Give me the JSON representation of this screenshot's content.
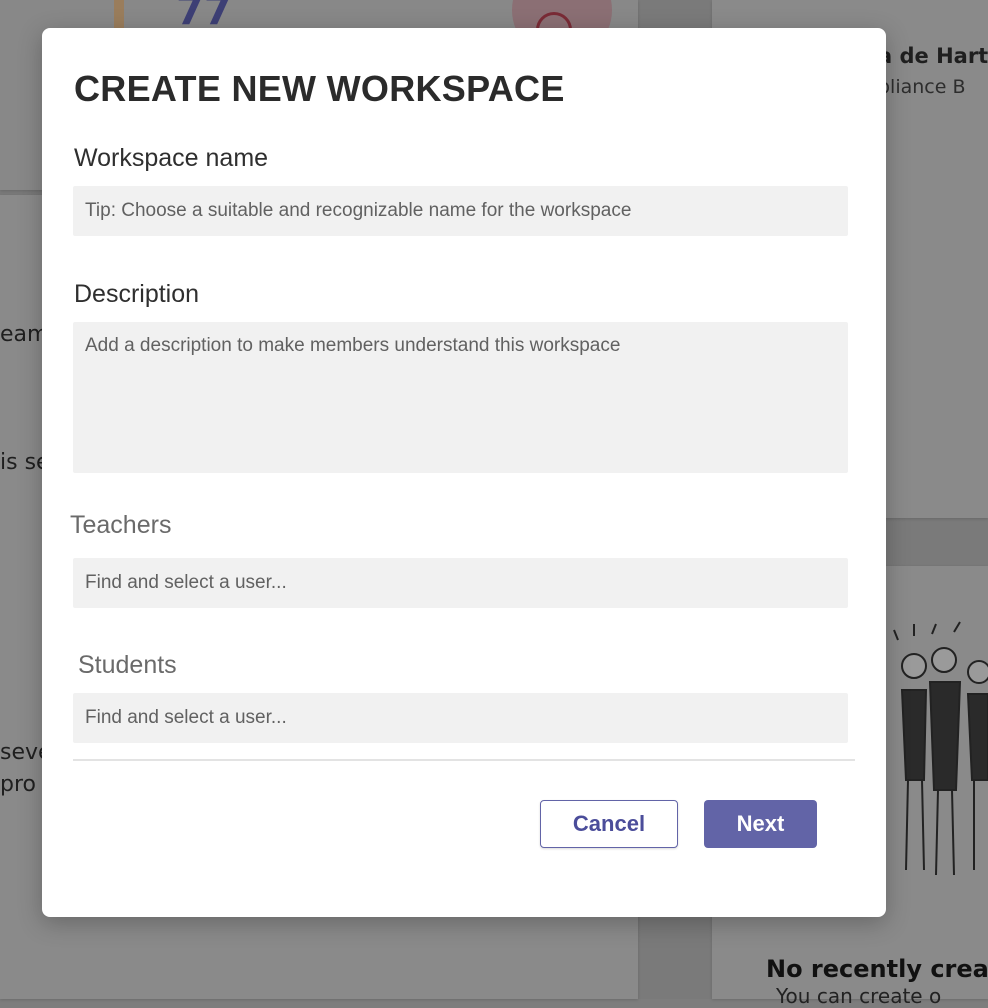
{
  "background": {
    "stat_value": "77",
    "profile_name": "a de Hart",
    "profile_role": "pliance B",
    "text_fragments": [
      "eam",
      "is se",
      "seve",
      "pro"
    ],
    "empty_state_title": "No recently creat",
    "empty_state_subtitle": "You can create o"
  },
  "dialog": {
    "title": "CREATE NEW WORKSPACE",
    "workspace_name": {
      "label": "Workspace name",
      "value": "",
      "placeholder": "Tip: Choose a suitable and recognizable name for the workspace"
    },
    "description": {
      "label": "Description",
      "value": "",
      "placeholder": "Add a description to make members understand this workspace"
    },
    "teachers": {
      "label": "Teachers",
      "value": "",
      "placeholder": "Find and select a user..."
    },
    "students": {
      "label": "Students",
      "value": "",
      "placeholder": "Find and select a user..."
    },
    "buttons": {
      "cancel": "Cancel",
      "next": "Next"
    }
  },
  "colors": {
    "accent": "#6264a7",
    "field_bg": "#f1f1f1",
    "overlay": "#7a7a7a"
  }
}
